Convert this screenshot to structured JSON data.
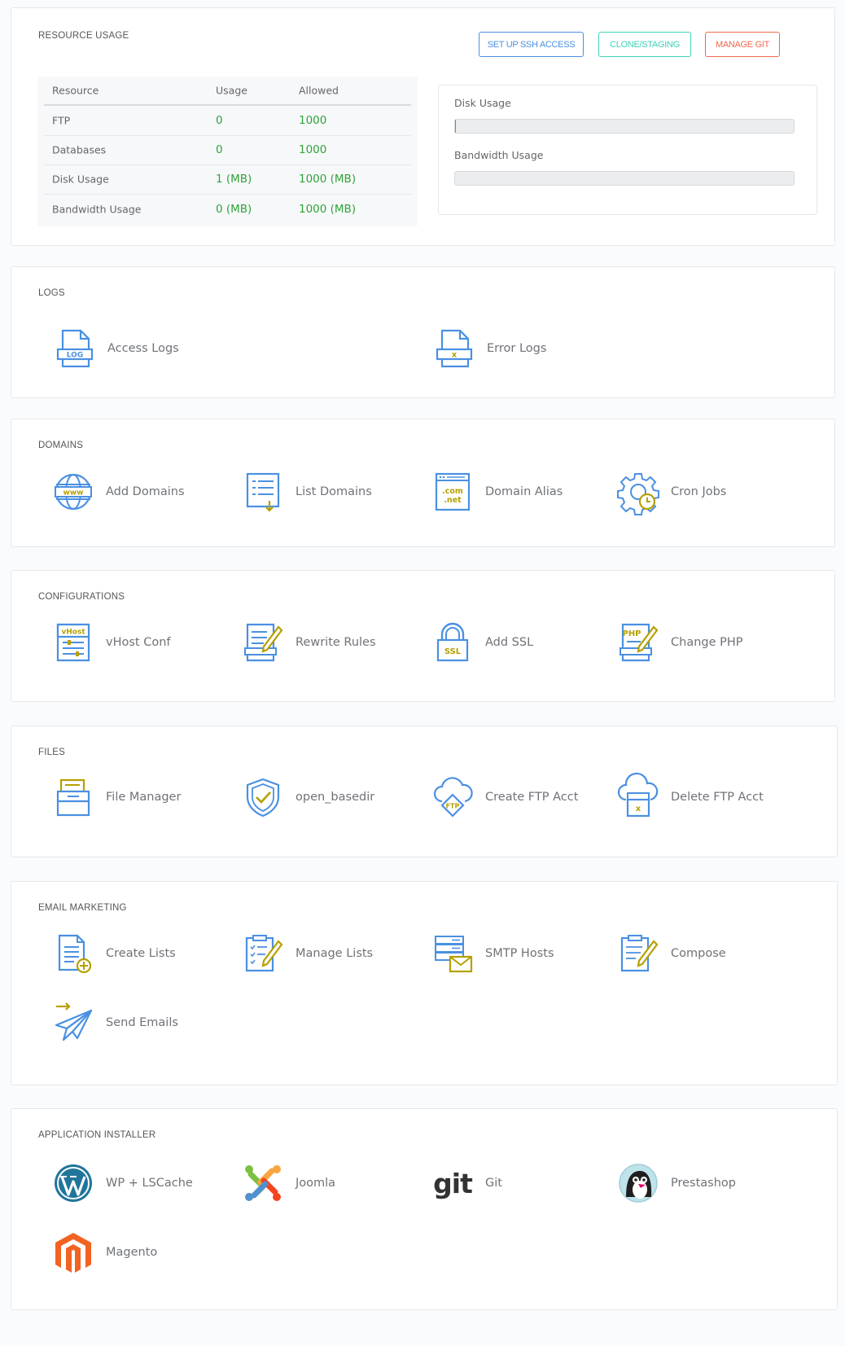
{
  "resource": {
    "title": "RESOURCE USAGE",
    "buttons": [
      {
        "label": "SET UP SSH ACCESS",
        "color": "#4a90e2"
      },
      {
        "label": "CLONE/STAGING",
        "color": "#3fd1b8"
      },
      {
        "label": "MANAGE GIT",
        "color": "#f06a4e"
      }
    ],
    "table": {
      "headers": [
        "Resource",
        "Usage",
        "Allowed"
      ],
      "rows": [
        [
          "FTP",
          "0",
          "1000"
        ],
        [
          "Databases",
          "0",
          "1000"
        ],
        [
          "Disk Usage",
          "1 (MB)",
          "1000 (MB)"
        ],
        [
          "Bandwidth Usage",
          "0 (MB)",
          "1000 (MB)"
        ]
      ]
    },
    "disk_label": "Disk Usage",
    "disk_fraction": 0.001,
    "bandwidth_label": "Bandwidth Usage",
    "bandwidth_fraction": 0
  },
  "logs": {
    "title": "LOGS",
    "items": [
      {
        "label": "Access Logs",
        "icon": "log-file-icon"
      },
      {
        "label": "Error Logs",
        "icon": "error-file-icon"
      }
    ]
  },
  "domains": {
    "title": "DOMAINS",
    "items": [
      {
        "label": "Add Domains",
        "icon": "www-globe-icon"
      },
      {
        "label": "List Domains",
        "icon": "list-icon"
      },
      {
        "label": "Domain Alias",
        "icon": "com-net-icon"
      },
      {
        "label": "Cron Jobs",
        "icon": "gear-clock-icon"
      }
    ]
  },
  "configurations": {
    "title": "CONFIGURATIONS",
    "items": [
      {
        "label": "vHost Conf",
        "icon": "vhost-icon"
      },
      {
        "label": "Rewrite Rules",
        "icon": "doc-pencil-icon"
      },
      {
        "label": "Add SSL",
        "icon": "ssl-lock-icon"
      },
      {
        "label": "Change PHP",
        "icon": "php-doc-icon"
      }
    ]
  },
  "files": {
    "title": "FILES",
    "items": [
      {
        "label": "File Manager",
        "icon": "file-cabinet-icon"
      },
      {
        "label": "open_basedir",
        "icon": "shield-check-icon"
      },
      {
        "label": "Create FTP Acct",
        "icon": "ftp-cloud-icon"
      },
      {
        "label": "Delete FTP Acct",
        "icon": "cloud-delete-icon"
      }
    ]
  },
  "email": {
    "title": "EMAIL MARKETING",
    "items": [
      {
        "label": "Create Lists",
        "icon": "doc-plus-icon"
      },
      {
        "label": "Manage Lists",
        "icon": "clipboard-pencil-icon"
      },
      {
        "label": "SMTP Hosts",
        "icon": "server-mail-icon"
      },
      {
        "label": "Compose",
        "icon": "compose-icon"
      },
      {
        "label": "Send Emails",
        "icon": "paper-plane-icon"
      }
    ]
  },
  "apps": {
    "title": "APPLICATION INSTALLER",
    "items": [
      {
        "label": "WP + LSCache",
        "icon": "wordpress-logo-icon"
      },
      {
        "label": "Joomla",
        "icon": "joomla-logo-icon"
      },
      {
        "label": "Git",
        "icon": "git-logo-icon",
        "logo_text": "git"
      },
      {
        "label": "Prestashop",
        "icon": "prestashop-logo-icon"
      },
      {
        "label": "Magento",
        "icon": "magento-logo-icon"
      }
    ]
  }
}
